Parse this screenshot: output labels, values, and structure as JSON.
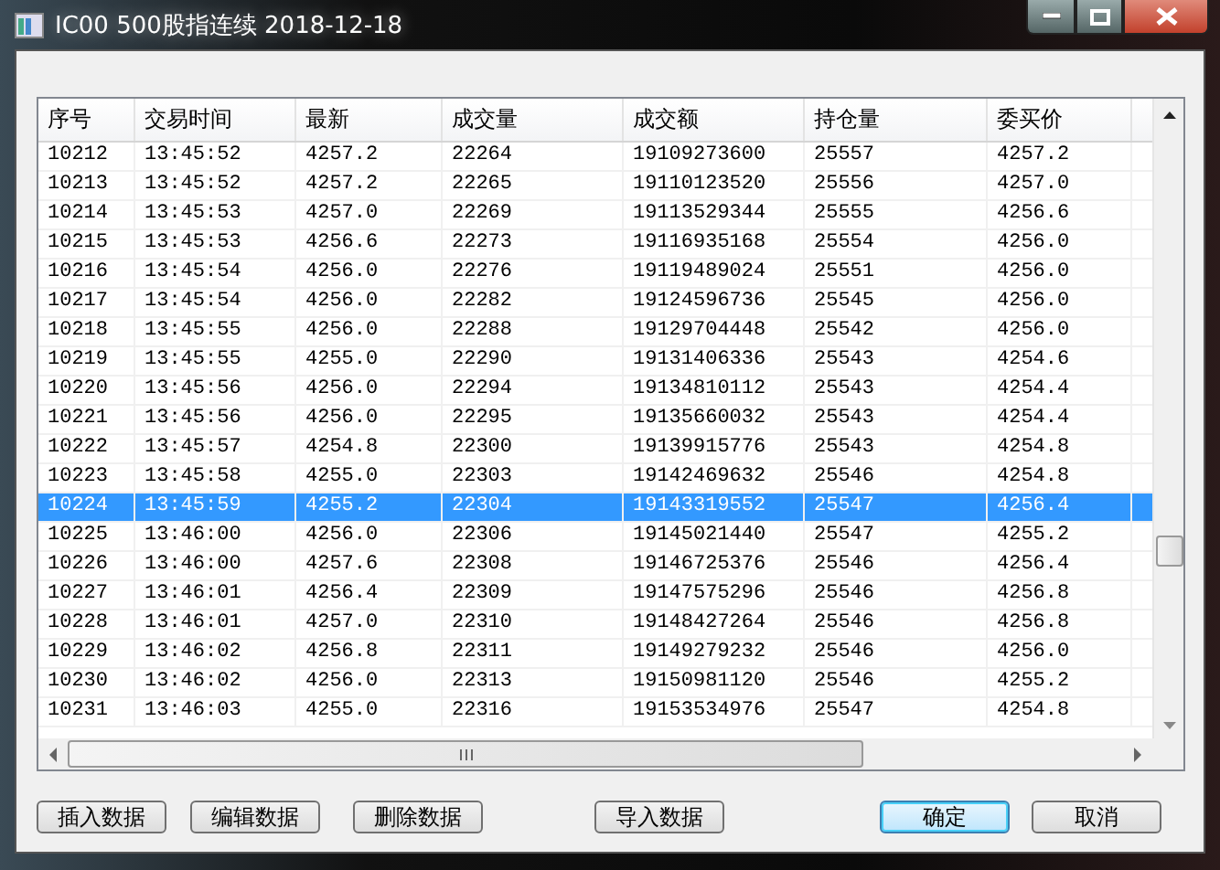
{
  "window": {
    "title": "IC00 500股指连续 2018-12-18"
  },
  "table": {
    "columns": [
      "序号",
      "交易时间",
      "最新",
      "成交量",
      "成交额",
      "持仓量",
      "委买价"
    ],
    "rows": [
      {
        "cells": [
          "10212",
          "13:45:52",
          "4257.2",
          "22264",
          "19109273600",
          "25557",
          "4257.2"
        ],
        "selected": false
      },
      {
        "cells": [
          "10213",
          "13:45:52",
          "4257.2",
          "22265",
          "19110123520",
          "25556",
          "4257.0"
        ],
        "selected": false
      },
      {
        "cells": [
          "10214",
          "13:45:53",
          "4257.0",
          "22269",
          "19113529344",
          "25555",
          "4256.6"
        ],
        "selected": false
      },
      {
        "cells": [
          "10215",
          "13:45:53",
          "4256.6",
          "22273",
          "19116935168",
          "25554",
          "4256.0"
        ],
        "selected": false
      },
      {
        "cells": [
          "10216",
          "13:45:54",
          "4256.0",
          "22276",
          "19119489024",
          "25551",
          "4256.0"
        ],
        "selected": false
      },
      {
        "cells": [
          "10217",
          "13:45:54",
          "4256.0",
          "22282",
          "19124596736",
          "25545",
          "4256.0"
        ],
        "selected": false
      },
      {
        "cells": [
          "10218",
          "13:45:55",
          "4256.0",
          "22288",
          "19129704448",
          "25542",
          "4256.0"
        ],
        "selected": false
      },
      {
        "cells": [
          "10219",
          "13:45:55",
          "4255.0",
          "22290",
          "19131406336",
          "25543",
          "4254.6"
        ],
        "selected": false
      },
      {
        "cells": [
          "10220",
          "13:45:56",
          "4256.0",
          "22294",
          "19134810112",
          "25543",
          "4254.4"
        ],
        "selected": false
      },
      {
        "cells": [
          "10221",
          "13:45:56",
          "4256.0",
          "22295",
          "19135660032",
          "25543",
          "4254.4"
        ],
        "selected": false
      },
      {
        "cells": [
          "10222",
          "13:45:57",
          "4254.8",
          "22300",
          "19139915776",
          "25543",
          "4254.8"
        ],
        "selected": false
      },
      {
        "cells": [
          "10223",
          "13:45:58",
          "4255.0",
          "22303",
          "19142469632",
          "25546",
          "4254.8"
        ],
        "selected": false
      },
      {
        "cells": [
          "10224",
          "13:45:59",
          "4255.2",
          "22304",
          "19143319552",
          "25547",
          "4256.4"
        ],
        "selected": true
      },
      {
        "cells": [
          "10225",
          "13:46:00",
          "4256.0",
          "22306",
          "19145021440",
          "25547",
          "4255.2"
        ],
        "selected": false
      },
      {
        "cells": [
          "10226",
          "13:46:00",
          "4257.6",
          "22308",
          "19146725376",
          "25546",
          "4256.4"
        ],
        "selected": false
      },
      {
        "cells": [
          "10227",
          "13:46:01",
          "4256.4",
          "22309",
          "19147575296",
          "25546",
          "4256.8"
        ],
        "selected": false
      },
      {
        "cells": [
          "10228",
          "13:46:01",
          "4257.0",
          "22310",
          "19148427264",
          "25546",
          "4256.8"
        ],
        "selected": false
      },
      {
        "cells": [
          "10229",
          "13:46:02",
          "4256.8",
          "22311",
          "19149279232",
          "25546",
          "4256.0"
        ],
        "selected": false
      },
      {
        "cells": [
          "10230",
          "13:46:02",
          "4256.0",
          "22313",
          "19150981120",
          "25546",
          "4255.2"
        ],
        "selected": false
      },
      {
        "cells": [
          "10231",
          "13:46:03",
          "4255.0",
          "22316",
          "19153534976",
          "25547",
          "4254.8"
        ],
        "selected": false
      }
    ]
  },
  "buttons": [
    {
      "label": "插入数据",
      "default": false
    },
    {
      "label": "编辑数据",
      "default": false
    },
    {
      "label": "删除数据",
      "default": false
    },
    {
      "label": "导入数据",
      "default": false
    },
    {
      "label": "确定",
      "default": true
    },
    {
      "label": "取消",
      "default": false
    }
  ]
}
